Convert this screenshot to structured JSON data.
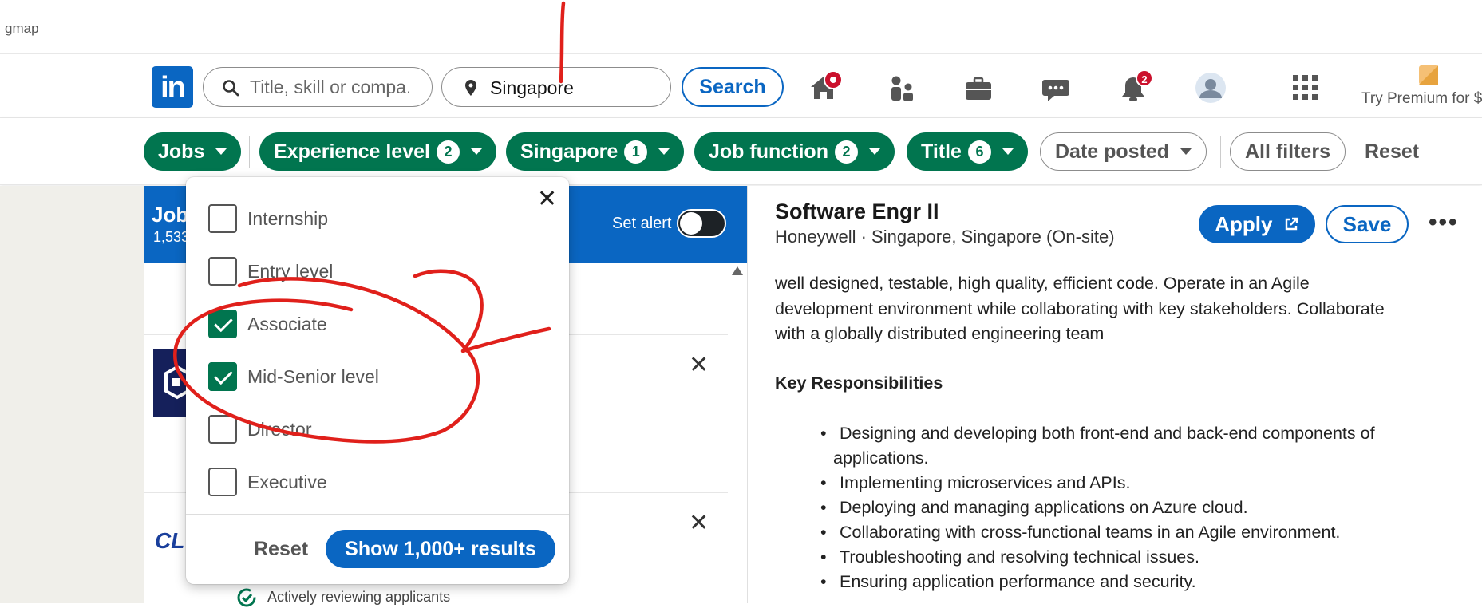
{
  "browser": {
    "crumb": "gmap"
  },
  "nav": {
    "logo": "in",
    "search_title_placeholder": "Title, skill or compa...",
    "search_location_value": "Singapore",
    "search_button": "Search",
    "notifications_count": "2",
    "premium": "Try Premium for $"
  },
  "filters": {
    "jobs": "Jobs",
    "experience_level": {
      "label": "Experience level",
      "count": "2"
    },
    "location": {
      "label": "Singapore",
      "count": "1"
    },
    "job_function": {
      "label": "Job function",
      "count": "2"
    },
    "title": {
      "label": "Title",
      "count": "6"
    },
    "date_posted": "Date posted",
    "all_filters": "All filters",
    "reset": "Reset"
  },
  "list": {
    "title": "Job",
    "count_text": "1,533",
    "set_alert": "Set alert",
    "actively_reviewing": "Actively reviewing applicants",
    "logo2_text": "CL"
  },
  "dropdown": {
    "options": [
      {
        "label": "Internship",
        "checked": false
      },
      {
        "label": "Entry level",
        "checked": false
      },
      {
        "label": "Associate",
        "checked": true
      },
      {
        "label": "Mid-Senior level",
        "checked": true
      },
      {
        "label": "Director",
        "checked": false
      },
      {
        "label": "Executive",
        "checked": false
      }
    ],
    "reset": "Reset",
    "show_results": "Show 1,000+ results"
  },
  "detail": {
    "title": "Software Engr II",
    "company": "Honeywell · Singapore, Singapore (On-site)",
    "apply": "Apply",
    "save": "Save",
    "more": "•••",
    "desc_lines": [
      "well designed, testable, high quality, efficient code. Operate in an Agile",
      "development environment while collaborating with key stakeholders. Collaborate",
      "with a globally distributed engineering team"
    ],
    "key_resp_heading": "Key Responsibilities",
    "bullets": [
      "Designing and developing both front-end and back-end components of",
      "Implementing microservices and APIs.",
      "Deploying and managing applications on Azure cloud.",
      "Collaborating with cross-functional teams in an Agile environment.",
      "Troubleshooting and resolving technical issues.",
      "Ensuring application performance and security."
    ],
    "bullet1_cont": "applications."
  },
  "colors": {
    "brand_blue": "#0a66c2",
    "filter_green": "#01754f",
    "annotation_red": "#e0201b",
    "badge_red": "#cb112d"
  }
}
